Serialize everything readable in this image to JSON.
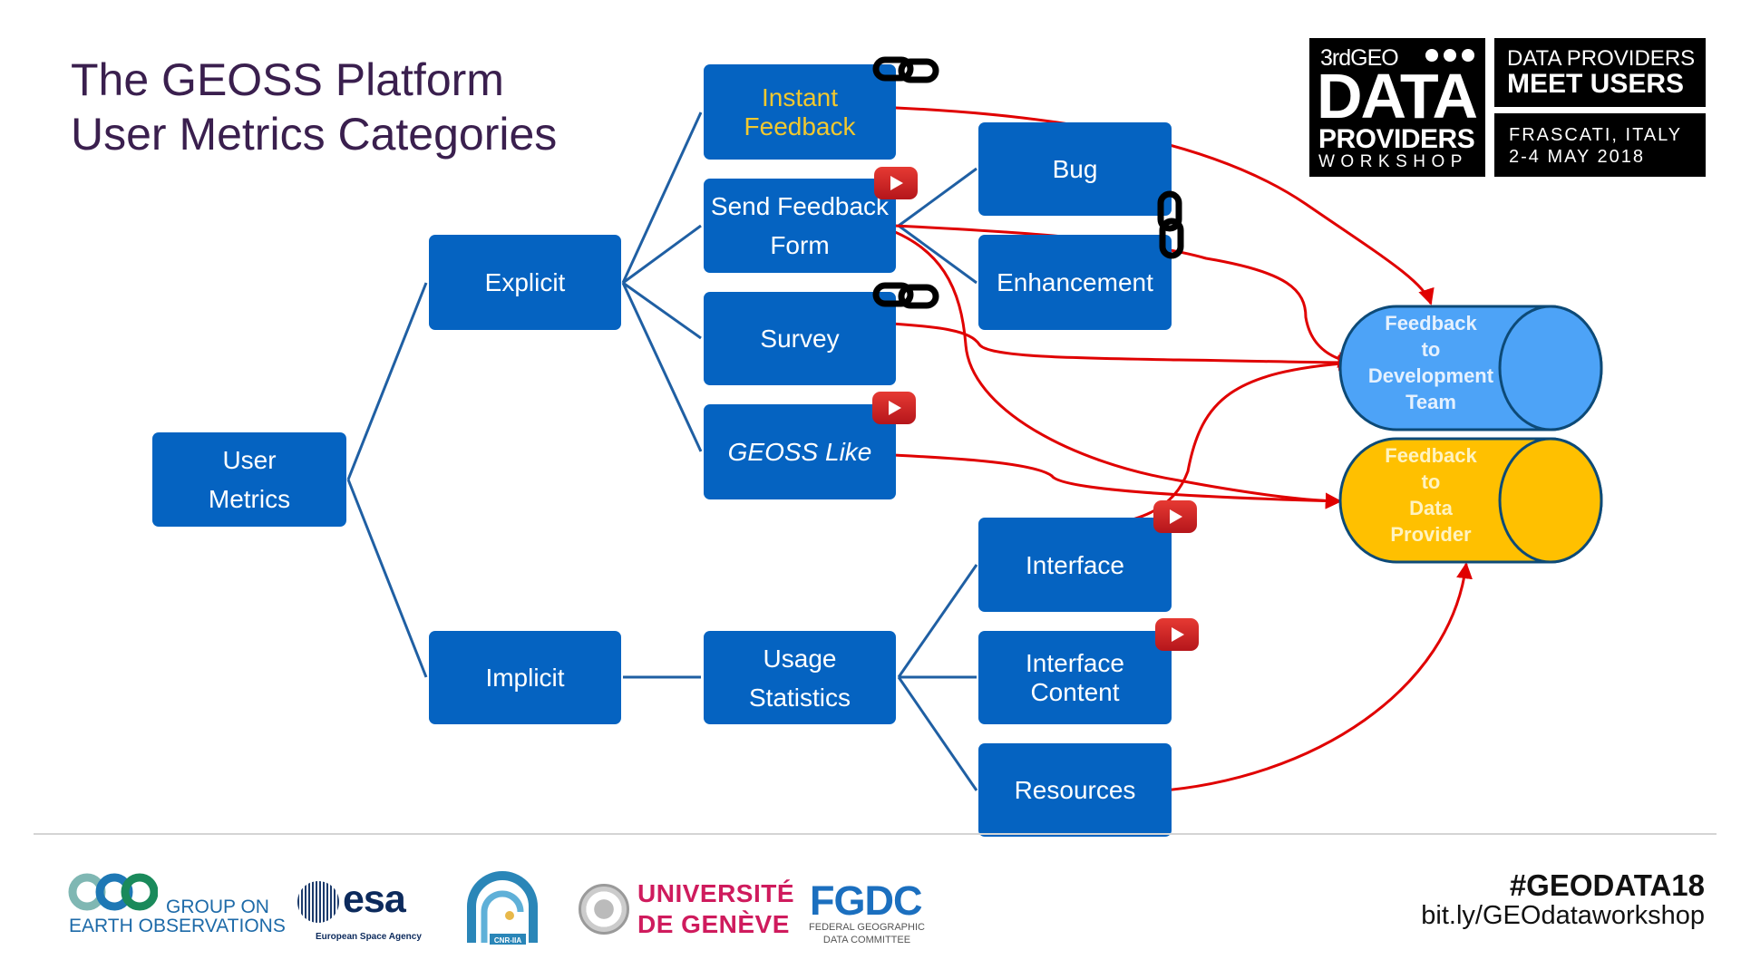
{
  "slide": {
    "title_lines": [
      "The GEOSS Platform",
      "User Metrics Categories"
    ]
  },
  "nodes": {
    "user_metrics": [
      "User",
      "Metrics"
    ],
    "explicit": "Explicit",
    "implicit": "Implicit",
    "instant_feedback": [
      "Instant",
      "Feedback"
    ],
    "send_feedback_form": [
      "Send Feedback",
      "Form"
    ],
    "survey": "Survey",
    "geoss_like": "GEOSS Like",
    "usage_statistics": [
      "Usage",
      "Statistics"
    ],
    "bug": "Bug",
    "enhancement": "Enhancement",
    "interface": "Interface",
    "interface_content": [
      "Interface",
      "Content"
    ],
    "resources": "Resources"
  },
  "targets": {
    "dev_team": [
      "Feedback",
      "to",
      "Development",
      "Team"
    ],
    "data_provider": [
      "Feedback",
      "to",
      "Data",
      "Provider"
    ]
  },
  "colors": {
    "box": "#0563c1",
    "instant_text": "#f2c82e",
    "dev_cylinder": "#4da3f7",
    "provider_cylinder": "#ffc000",
    "arrow": "#e00000",
    "tree_line": "#1f5fa3"
  },
  "icons": {
    "video": "youtube-play-icon",
    "link": "chain-link-icon"
  },
  "event_badge": {
    "edition": "3rd",
    "org": "GEO",
    "data": "DATA",
    "providers": "PROVIDERS",
    "workshop": "WORKSHOP",
    "tagline_1": "DATA PROVIDERS",
    "tagline_2": "MEET USERS",
    "place": "FRASCATI, ITALY",
    "dates": "2-4 MAY 2018"
  },
  "footer": {
    "hashtag": "#GEODATA18",
    "url": "bit.ly/GEOdataworkshop",
    "logos": {
      "geo_line1": "GROUP ON",
      "geo_line2": "EARTH OBSERVATIONS",
      "esa": "esa",
      "esa_sub": "European Space Agency",
      "cnr": "CNR-IIA",
      "unige_1": "UNIVERSITÉ",
      "unige_2": "DE GENÈVE",
      "fgdc": "FGDC",
      "fgdc_sub1": "FEDERAL GEOGRAPHIC",
      "fgdc_sub2": "DATA COMMITTEE"
    }
  }
}
